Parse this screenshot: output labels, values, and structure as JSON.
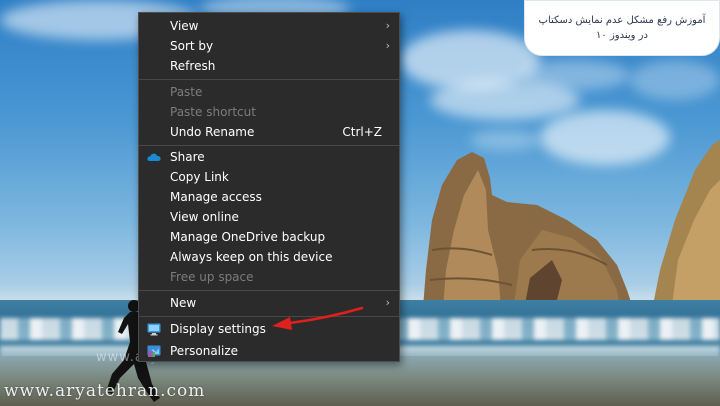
{
  "title_card": {
    "line1": "آموزش رفع مشکل عدم نمایش دسکتاپ",
    "line2": "در ویندوز ۱۰"
  },
  "watermark": {
    "mid_text": "www.aryatehran.com",
    "bottom_text": "www.aryatehran.com"
  },
  "context_menu": {
    "view": {
      "label": "View",
      "submenu_icon": "chevron-right-icon"
    },
    "sort_by": {
      "label": "Sort by",
      "submenu_icon": "chevron-right-icon"
    },
    "refresh": {
      "label": "Refresh"
    },
    "paste": {
      "label": "Paste",
      "enabled": false
    },
    "paste_shortcut": {
      "label": "Paste shortcut",
      "enabled": false
    },
    "undo_rename": {
      "label": "Undo Rename",
      "shortcut": "Ctrl+Z"
    },
    "share": {
      "label": "Share",
      "icon": "onedrive-cloud-icon"
    },
    "copy_link": {
      "label": "Copy Link"
    },
    "manage_access": {
      "label": "Manage access"
    },
    "view_online": {
      "label": "View online"
    },
    "manage_onedrive_backup": {
      "label": "Manage OneDrive backup"
    },
    "always_keep": {
      "label": "Always keep on this device"
    },
    "free_up_space": {
      "label": "Free up space",
      "enabled": false
    },
    "new": {
      "label": "New",
      "submenu_icon": "chevron-right-icon"
    },
    "display_settings": {
      "label": "Display settings",
      "icon": "display-icon"
    },
    "personalize": {
      "label": "Personalize",
      "icon": "personalize-icon"
    }
  },
  "annotation": {
    "icon": "red-arrow-icon",
    "color": "#e0201c"
  },
  "colors": {
    "menu_bg": "#2b2b2b",
    "menu_text": "#ffffff",
    "disabled_text": "#7c7c7c",
    "onedrive_blue": "#1a8ad4"
  }
}
